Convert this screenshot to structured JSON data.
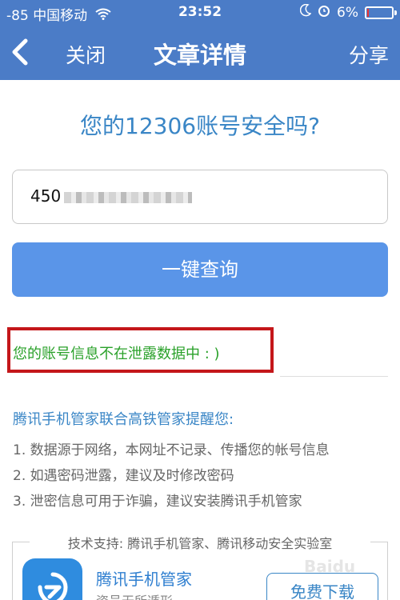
{
  "status_bar": {
    "signal": "-85",
    "carrier": "中国移动",
    "time": "23:52",
    "battery": "6%",
    "battery_level": 0.06,
    "icons": [
      "wifi-icon",
      "moon-icon",
      "alarm-icon",
      "battery-icon"
    ]
  },
  "nav": {
    "back_icon": "chevron-left-icon",
    "close": "关闭",
    "title": "文章详情",
    "share": "分享"
  },
  "main": {
    "headline": "您的12306账号安全吗?",
    "input_value": "450",
    "query_button": "一键查询",
    "result": "您的账号信息不在泄露数据中 : )"
  },
  "tips": {
    "heading": "腾讯手机管家联合高铁管家提醒您:",
    "items": [
      "1. 数据源于网络，本网址不记录、传播您的帐号信息",
      "2. 如遇密码泄露，建议及时修改密码",
      "3. 泄密信息可用于诈骗，建议安装腾讯手机管家"
    ]
  },
  "support": {
    "text": "技术支持: 腾讯手机管家、腾讯移动安全实验室",
    "app_name": "腾讯手机管家",
    "app_sub": "资号无所遁形",
    "download": "免费下载",
    "watermark": "Baidu"
  },
  "colors": {
    "nav_bg": "#4b7cc7",
    "headline": "#3a86c6",
    "query_button_bg": "#5a95e8",
    "result_green": "#2aa12a",
    "highlight_red": "#c4171a"
  }
}
